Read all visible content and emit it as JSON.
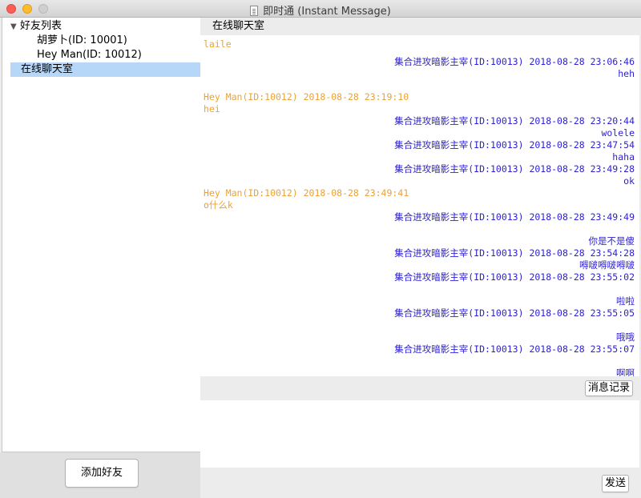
{
  "window": {
    "title": "即时通 (Instant Message)"
  },
  "sidebar": {
    "root_label": "好友列表",
    "friends": [
      {
        "label": "胡萝卜(ID: 10001)"
      },
      {
        "label": "Hey Man(ID: 10012)"
      }
    ],
    "selected_label": "在线聊天室",
    "add_friend_button": "添加好友"
  },
  "chat": {
    "room_label": "在线聊天室",
    "messages": [
      {
        "text": "laile",
        "side": "left"
      },
      {
        "text": "集合进攻暗影主宰(ID:10013) 2018-08-28 23:06:46",
        "side": "right"
      },
      {
        "text": "heh",
        "side": "right"
      },
      {
        "text": "Hey Man(ID:10012) 2018-08-28 23:19:10",
        "side": "left"
      },
      {
        "text": "hei",
        "side": "left"
      },
      {
        "text": "集合进攻暗影主宰(ID:10013) 2018-08-28 23:20:44",
        "side": "right"
      },
      {
        "text": "wolele",
        "side": "right"
      },
      {
        "text": "集合进攻暗影主宰(ID:10013) 2018-08-28 23:47:54",
        "side": "right"
      },
      {
        "text": "haha",
        "side": "right"
      },
      {
        "text": "集合进攻暗影主宰(ID:10013) 2018-08-28 23:49:28",
        "side": "right"
      },
      {
        "text": "ok",
        "side": "right"
      },
      {
        "text": "Hey Man(ID:10012) 2018-08-28 23:49:41",
        "side": "left"
      },
      {
        "text": "o什么k",
        "side": "left"
      },
      {
        "text": "集合进攻暗影主宰(ID:10013) 2018-08-28 23:49:49",
        "side": "right"
      },
      {
        "text": "你是不是傻",
        "side": "right"
      },
      {
        "text": "集合进攻暗影主宰(ID:10013) 2018-08-28 23:54:28",
        "side": "right"
      },
      {
        "text": "嘚啵嘚啵嘚啵",
        "side": "right"
      },
      {
        "text": "集合进攻暗影主宰(ID:10013) 2018-08-28 23:55:02",
        "side": "right"
      },
      {
        "text": "啦啦",
        "side": "right"
      },
      {
        "text": "集合进攻暗影主宰(ID:10013) 2018-08-28 23:55:05",
        "side": "right"
      },
      {
        "text": "哦哦",
        "side": "right"
      },
      {
        "text": "集合进攻暗影主宰(ID:10013) 2018-08-28 23:55:07",
        "side": "right"
      },
      {
        "text": "啊啊",
        "side": "right"
      }
    ],
    "history_button": "消息记录",
    "input_value": "",
    "send_button": "发送"
  },
  "colors": {
    "left_message": "#eaa238",
    "right_message": "#2b1fd2",
    "selection": "#b6d7f8"
  }
}
